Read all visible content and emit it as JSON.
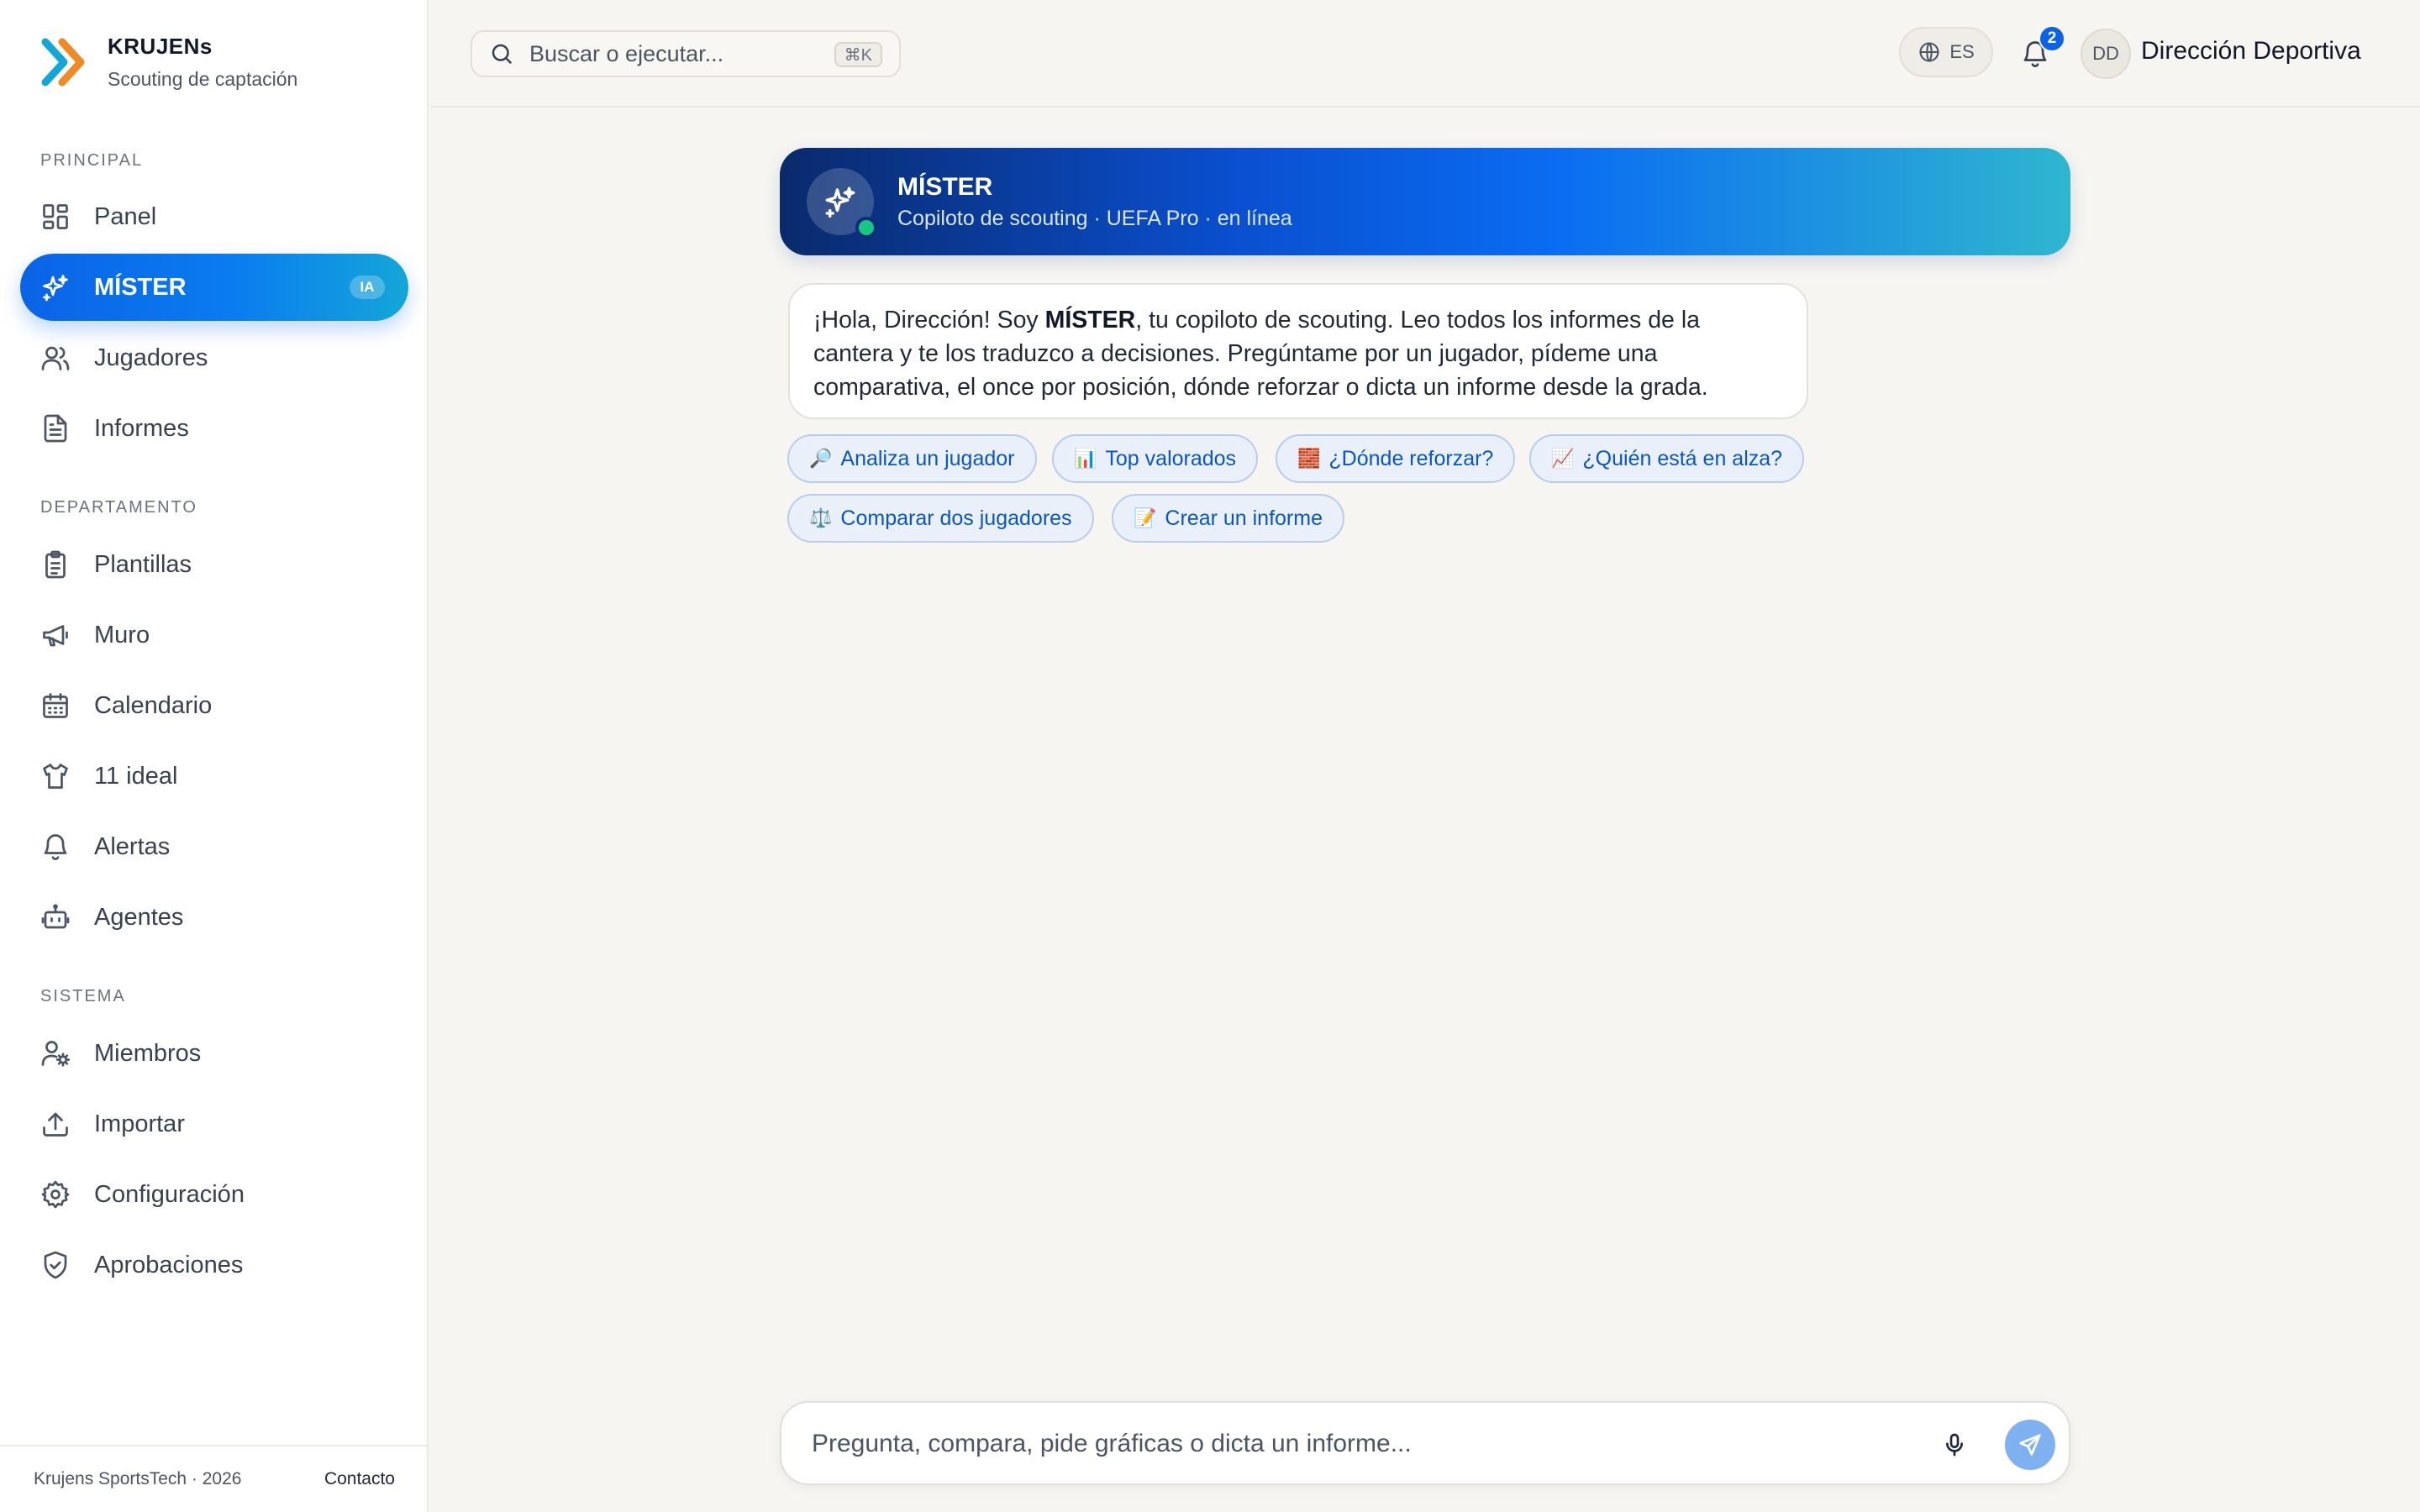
{
  "brand": {
    "name": "KRUJENs",
    "subtitle": "Scouting de captación"
  },
  "sidebar": {
    "sections": [
      {
        "label": "PRINCIPAL"
      },
      {
        "label": "DEPARTAMENTO"
      },
      {
        "label": "SISTEMA"
      }
    ],
    "items": [
      {
        "label": "Panel",
        "icon": "dashboard-icon"
      },
      {
        "label": "MÍSTER",
        "icon": "sparkles-icon",
        "badge": "IA",
        "active": true
      },
      {
        "label": "Jugadores",
        "icon": "users-icon"
      },
      {
        "label": "Informes",
        "icon": "file-text-icon"
      },
      {
        "label": "Plantillas",
        "icon": "clipboard-icon"
      },
      {
        "label": "Muro",
        "icon": "megaphone-icon"
      },
      {
        "label": "Calendario",
        "icon": "calendar-icon"
      },
      {
        "label": "11 ideal",
        "icon": "shirt-icon"
      },
      {
        "label": "Alertas",
        "icon": "bell-icon"
      },
      {
        "label": "Agentes",
        "icon": "bot-icon"
      },
      {
        "label": "Miembros",
        "icon": "user-cog-icon"
      },
      {
        "label": "Importar",
        "icon": "upload-icon"
      },
      {
        "label": "Configuración",
        "icon": "gear-icon"
      },
      {
        "label": "Aprobaciones",
        "icon": "shield-check-icon"
      }
    ],
    "footer": {
      "copyright": "Krujens SportsTech · 2026",
      "contact": "Contacto"
    }
  },
  "topbar": {
    "search": {
      "placeholder": "Buscar o ejecutar...",
      "shortcut": "⌘K"
    },
    "language": "ES",
    "notifications": "2",
    "user": {
      "initials": "DD",
      "name": "Dirección Deportiva"
    }
  },
  "chat": {
    "assistant": {
      "name": "MÍSTER",
      "status": "Copiloto de scouting · UEFA Pro · en línea"
    },
    "greeting": {
      "before": "¡Hola, Dirección! Soy ",
      "bold": "MÍSTER",
      "after": ", tu copiloto de scouting. Leo todos los informes de la cantera y te los traduzco a decisiones. Pregúntame por un jugador, pídeme una comparativa, el once por posición, dónde reforzar o dicta un informe desde la grada."
    },
    "suggestions": [
      {
        "emoji": "🔎",
        "label": "Analiza un jugador"
      },
      {
        "emoji": "📊",
        "label": "Top valorados"
      },
      {
        "emoji": "🧱",
        "label": "¿Dónde reforzar?"
      },
      {
        "emoji": "📈",
        "label": "¿Quién está en alza?"
      },
      {
        "emoji": "⚖️",
        "label": "Comparar dos jugadores"
      },
      {
        "emoji": "📝",
        "label": "Crear un informe"
      }
    ],
    "composer": {
      "placeholder": "Pregunta, compara, pide gráficas o dicta un informe..."
    }
  },
  "colors": {
    "accent": "#0b63e6",
    "online": "#16c784",
    "background": "#f6f5f1"
  }
}
